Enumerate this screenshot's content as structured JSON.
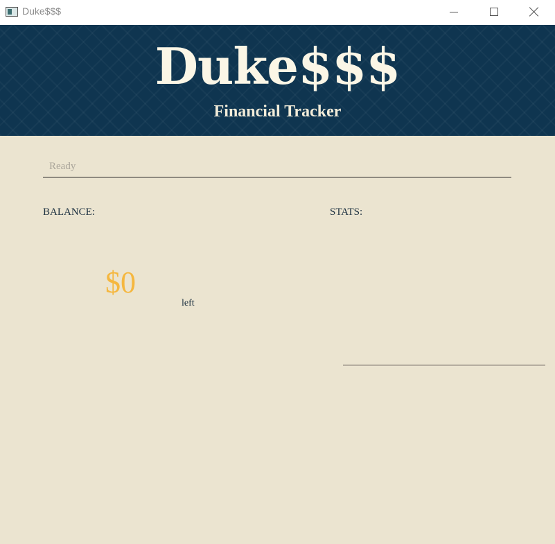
{
  "window": {
    "title": "Duke$$$"
  },
  "header": {
    "title": "Duke$$$",
    "subtitle": "Financial Tracker"
  },
  "command": {
    "placeholder": "Ready",
    "value": ""
  },
  "balance": {
    "label": "BALANCE:",
    "amount": "$0",
    "suffix": "left"
  },
  "stats": {
    "label": "STATS:"
  },
  "colors": {
    "header_bg": "#0f3550",
    "body_bg": "#ebe4d0",
    "accent_amount": "#f5b73f",
    "title_text": "#fbf6e6"
  },
  "icons": {
    "app": "app-icon",
    "minimize": "minimize-icon",
    "maximize": "maximize-icon",
    "close": "close-icon"
  }
}
